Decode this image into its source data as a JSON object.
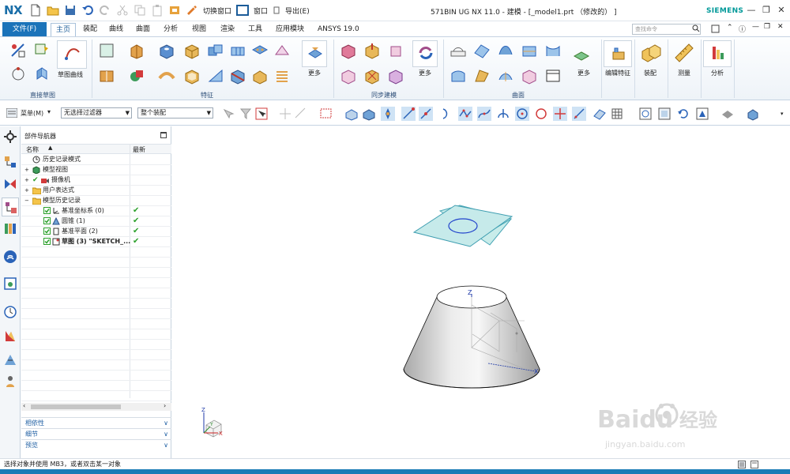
{
  "app": {
    "logo": "NX",
    "title": "571BIN UG NX 11.0 - 建模 - [_model1.prt （修改的） ]",
    "brand": "SIEMENS",
    "accent": "#1b73b9"
  },
  "quick_access": {
    "switch_window": "切换窗口",
    "window": "窗口",
    "export": "导出(E)"
  },
  "menu": {
    "file": "文件(F)",
    "tabs": [
      "主页",
      "装配",
      "曲线",
      "曲面",
      "分析",
      "视图",
      "渲染",
      "工具",
      "应用模块",
      "ANSYS 19.0"
    ],
    "active_tab": "主页",
    "command_finder_placeholder": "查找命令"
  },
  "ribbon": {
    "groups": [
      {
        "label": "直接草图"
      },
      {
        "label": "特征"
      },
      {
        "label": "同步建模"
      },
      {
        "label": "曲面"
      }
    ],
    "sketch_curve": "草图曲线",
    "more": "更多",
    "edit_feature": "编辑特征",
    "assembly": "装配",
    "measure": "测量",
    "analysis": "分析"
  },
  "toolbar2": {
    "menu": "菜单(M)",
    "filter": "无选择过滤器",
    "scope": "整个装配"
  },
  "navigator": {
    "title": "部件导航器",
    "col_name": "名称",
    "col_latest": "最新",
    "rows": [
      {
        "label": "历史记录模式"
      },
      {
        "label": "模型视图"
      },
      {
        "label": "摄像机"
      },
      {
        "label": "用户表达式"
      },
      {
        "label": "模型历史记录"
      },
      {
        "label": "基准坐标系 (0)"
      },
      {
        "label": "圆锥 (1)"
      },
      {
        "label": "基准平面 (2)"
      },
      {
        "label": "草图 (3) \"SKETCH_..."
      }
    ],
    "accordion": [
      "相依性",
      "细节",
      "预览"
    ]
  },
  "viewport": {
    "axis_z": "Z",
    "axis_x": "X",
    "triad_z": "Z",
    "triad_x": "X",
    "triad_y": "Y"
  },
  "status": {
    "text": "选择对象并使用 MB3，或者双击某一对象"
  },
  "watermark": {
    "brand": "Baidu",
    "cn": "经验",
    "url": "jingyan.baidu.com"
  }
}
